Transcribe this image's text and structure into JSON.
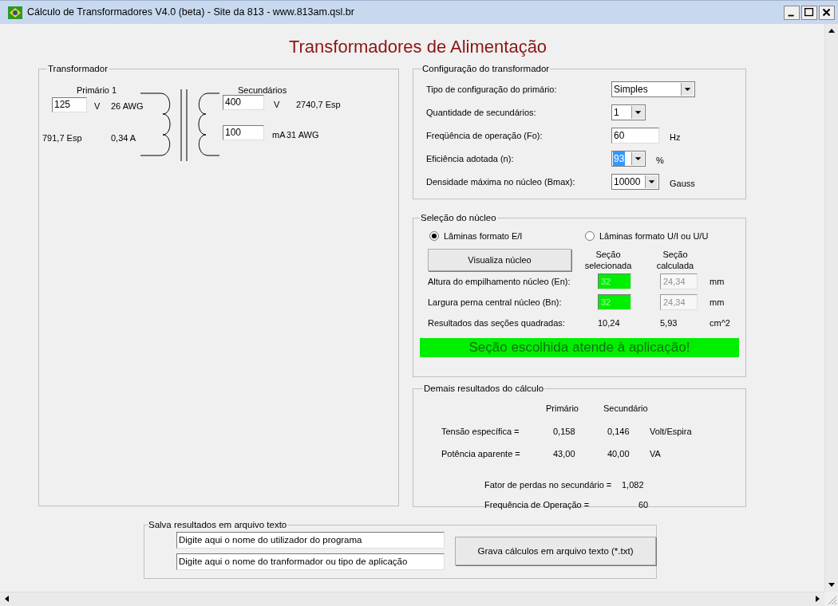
{
  "window": {
    "title": "Cálculo de Transformadores V4.0 (beta) - Site da 813 - www.813am.qsl.br"
  },
  "heading": "Transformadores de Alimentação",
  "transformer": {
    "title": "Transformador",
    "primary_label": "Primário 1",
    "secondary_label": "Secundários",
    "primary_voltage": "125",
    "primary_voltage_unit": "V",
    "primary_wire": "26 AWG",
    "primary_turns": "791,7 Esp",
    "primary_current": "0,34 A",
    "secondary_voltage": "400",
    "secondary_voltage_unit": "V",
    "secondary_turns": "2740,7 Esp",
    "secondary_current": "100",
    "secondary_current_unit": "mA",
    "secondary_wire": "31 AWG"
  },
  "config": {
    "title": "Configuração do transformador",
    "rows": [
      {
        "kind": "dropdown",
        "label": "Tipo de configuração do primário:",
        "value": "Simples",
        "highlighted": false
      },
      {
        "kind": "dropdown",
        "label": "Quantidade de secundários:",
        "value": "1",
        "highlighted": false
      },
      {
        "kind": "input",
        "label": "Freqüência de operação (Fo):",
        "value": "60",
        "unit": "Hz",
        "highlighted": false
      },
      {
        "kind": "dropdown",
        "label": "Eficiência adotada (n):",
        "value": "93",
        "unit": "%",
        "highlighted": true
      },
      {
        "kind": "dropdown",
        "label": "Densidade máxima no núcleo (Bmax):",
        "value": "10000",
        "unit": "Gauss",
        "highlighted": false
      }
    ]
  },
  "core": {
    "title": "Seleção do núcleo",
    "options": [
      {
        "label": "Lâminas formato E/I",
        "selected": true
      },
      {
        "label": "Lâminas formato  U/I ou U/U",
        "selected": false
      }
    ],
    "view_button": "Visualiza núcleo",
    "columns": [
      "Seção selecionada",
      "Seção calculada"
    ],
    "rows": [
      {
        "label": "Altura do empilhamento núcleo (En):",
        "selected_value": "32",
        "calculated_value": "24,34",
        "unit": "mm"
      },
      {
        "label": "Largura perna central núcleo (Bn):",
        "selected_value": "32",
        "calculated_value": "24,34",
        "unit": "mm"
      }
    ],
    "result": {
      "label": "Resultados das seções quadradas:",
      "selected_value": "10,24",
      "calculated_value": "5,93",
      "unit": "cm^2"
    },
    "status": "Seção escolhida atende à aplicação!"
  },
  "results": {
    "title": "Demais resultados do cálculo",
    "columns": [
      "Primário",
      "Secundário"
    ],
    "rows": [
      {
        "label": "Tensão específica =",
        "primary": "0,158",
        "secondary": "0,146",
        "unit": "Volt/Espira"
      },
      {
        "label": "Potência aparente =",
        "primary": "43,00",
        "secondary": "40,00",
        "unit": "VA"
      }
    ],
    "extras": [
      {
        "label": "Fator de perdas no secundário =",
        "value": "1,082"
      },
      {
        "label": "Frequência de Operação =",
        "value": "60"
      }
    ]
  },
  "save": {
    "title": "Salva resultados em arquivo texto",
    "fields": [
      "Digite aqui o nome do utilizador do programa",
      "Digite aqui o nome do tranformador ou tipo de aplicação"
    ],
    "button": "Grava cálculos em arquivo texto (*.txt)"
  }
}
